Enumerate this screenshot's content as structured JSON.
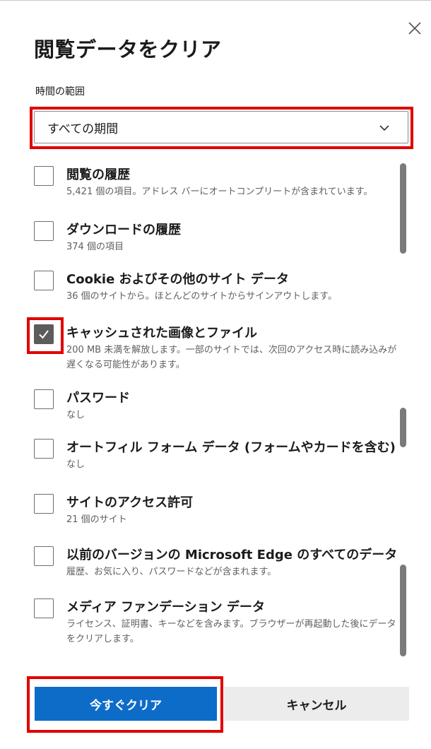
{
  "dialog": {
    "title": "閲覧データをクリア",
    "close_icon": "close-icon"
  },
  "time_range": {
    "label": "時間の範囲",
    "selected": "すべての期間",
    "icon": "chevron-down-icon"
  },
  "items": [
    {
      "label": "閲覧の履歴",
      "desc": "5,421 個の項目。アドレス バーにオートコンプリートが含まれています。",
      "checked": false
    },
    {
      "label": "ダウンロードの履歴",
      "desc": "374 個の項目",
      "checked": false
    },
    {
      "label": "Cookie およびその他のサイト データ",
      "desc": "36 個のサイトから。ほとんどのサイトからサインアウトします。",
      "checked": false
    },
    {
      "label": "キャッシュされた画像とファイル",
      "desc": "200 MB 未満を解放します。一部のサイトでは、次回のアクセス時に読み込みが遅くなる可能性があります。",
      "checked": true
    },
    {
      "label": "パスワード",
      "desc": "なし",
      "checked": false
    },
    {
      "label": "オートフィル フォーム データ (フォームやカードを含む)",
      "desc": "なし",
      "checked": false
    },
    {
      "label": "サイトのアクセス許可",
      "desc": "21 個のサイト",
      "checked": false
    },
    {
      "label": "以前のバージョンの Microsoft Edge のすべてのデータ",
      "desc": "履歴、お気に入り、パスワードなどが含まれます。",
      "checked": false
    },
    {
      "label": "メディア ファンデーション データ",
      "desc": "ライセンス、証明書、キーなどを含みます。ブラウザーが再起動した後にデータをクリアします。",
      "checked": false
    }
  ],
  "buttons": {
    "clear_now": "今すぐクリア",
    "cancel": "キャンセル"
  },
  "colors": {
    "primary": "#0e6cc9",
    "highlight": "#e00000",
    "checkbox_checked": "#5c5c5c"
  }
}
